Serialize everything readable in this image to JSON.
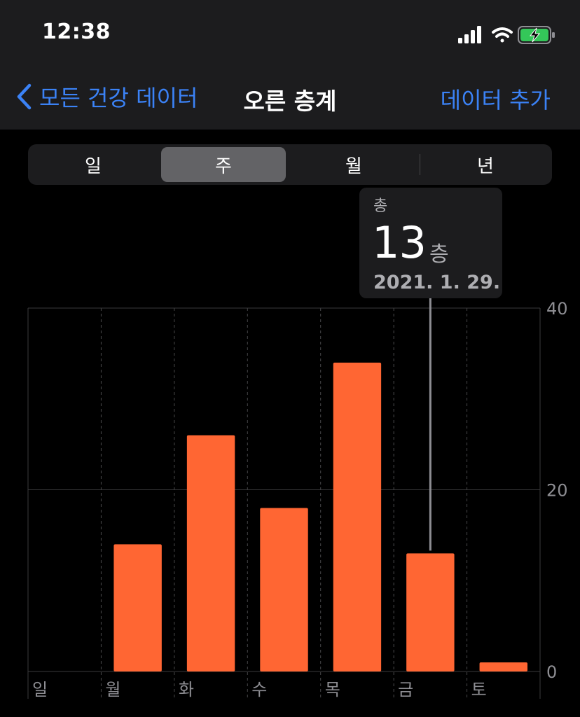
{
  "status": {
    "time": "12:38"
  },
  "nav": {
    "back_label": "모든 건강 데이터",
    "title": "오른 층계",
    "action_label": "데이터 추가"
  },
  "segments": {
    "items": [
      "일",
      "주",
      "월",
      "년"
    ],
    "selected": "주"
  },
  "tooltip": {
    "label": "총",
    "value": "13",
    "unit": "층",
    "date": "2021. 1. 29."
  },
  "colors": {
    "accent": "#3b82f6",
    "bar": "#ff6633",
    "background": "#000000",
    "bar_surface": "#1c1c1e"
  },
  "chart_data": {
    "type": "bar",
    "categories": [
      "일",
      "월",
      "화",
      "수",
      "목",
      "금",
      "토"
    ],
    "values": [
      0,
      14,
      26,
      18,
      34,
      13,
      1
    ],
    "ylim": [
      0,
      40
    ],
    "yticks": [
      0,
      20,
      40
    ],
    "highlighted_category": "금",
    "grid": true
  }
}
